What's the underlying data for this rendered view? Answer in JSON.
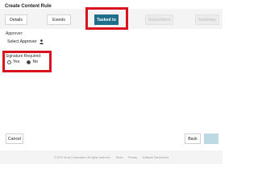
{
  "window": {
    "title": "Create Content Rule"
  },
  "steps": [
    {
      "label": "Details",
      "state": "done"
    },
    {
      "label": "Events",
      "state": "done"
    },
    {
      "label": "Tasked to",
      "state": "active"
    },
    {
      "label": "Subscribers",
      "state": "future"
    },
    {
      "label": "Summary",
      "state": "future"
    }
  ],
  "approver": {
    "label": "Approver:",
    "button_label": "Select Approver",
    "icon": "person-icon"
  },
  "signature": {
    "label": "Signature Required:",
    "options": [
      {
        "label": "Yes",
        "selected": false
      },
      {
        "label": "No",
        "selected": true
      }
    ]
  },
  "actions": {
    "cancel": "Cancel",
    "back": "Back",
    "next": ""
  },
  "footer": {
    "copyright": "© 2022 Array Corporation. All rights reserved.",
    "terms": "Terms",
    "privacy": "Privacy",
    "software": "Software Disclosures"
  },
  "colors": {
    "accent": "#1f6f8b",
    "highlight": "#d8121e",
    "next_disabled": "#bcd9e4"
  }
}
